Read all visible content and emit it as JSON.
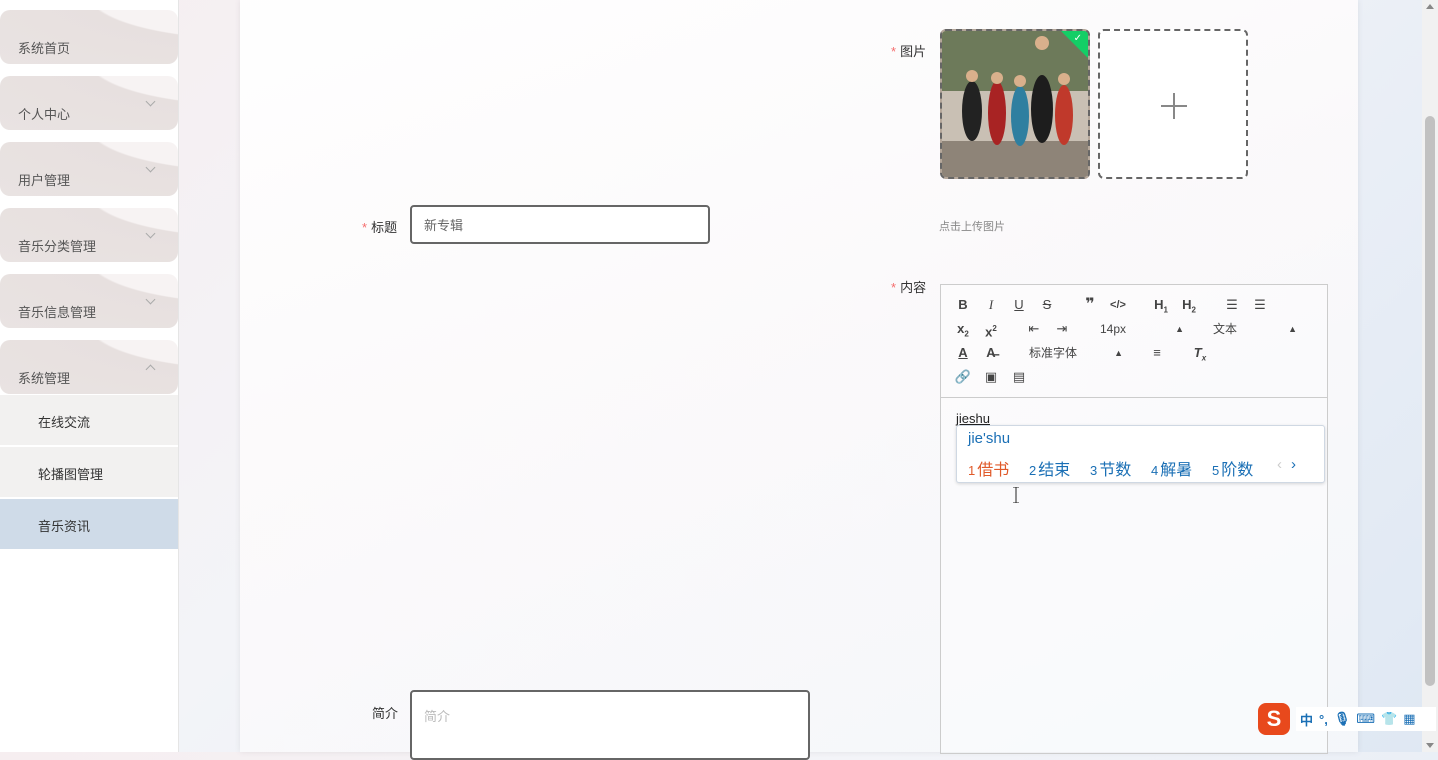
{
  "sidebar": {
    "items": [
      {
        "label": "系统首页"
      },
      {
        "label": "个人中心"
      },
      {
        "label": "用户管理"
      },
      {
        "label": "音乐分类管理"
      },
      {
        "label": "音乐信息管理"
      },
      {
        "label": "系统管理"
      }
    ],
    "sub_items": [
      {
        "label": "在线交流"
      },
      {
        "label": "轮播图管理"
      },
      {
        "label": "音乐资讯"
      }
    ]
  },
  "form": {
    "image_label": "图片",
    "upload_tip": "点击上传图片",
    "title_label": "标题",
    "title_value": "新专辑",
    "content_label": "内容",
    "intro_label": "简介",
    "intro_placeholder": "简介"
  },
  "editor": {
    "font_size": "14px",
    "block_type": "文本",
    "font_family": "标准字体",
    "content_text": "jieshu"
  },
  "ime": {
    "pinyin": "jie'shu",
    "candidates": [
      {
        "n": "1",
        "text": "借书"
      },
      {
        "n": "2",
        "text": "结束"
      },
      {
        "n": "3",
        "text": "节数"
      },
      {
        "n": "4",
        "text": "解暑"
      },
      {
        "n": "5",
        "text": "阶数"
      }
    ],
    "prev": "‹",
    "next": "›",
    "bar_logo": "S",
    "bar_mode": "中",
    "bar_punct": "°,"
  }
}
